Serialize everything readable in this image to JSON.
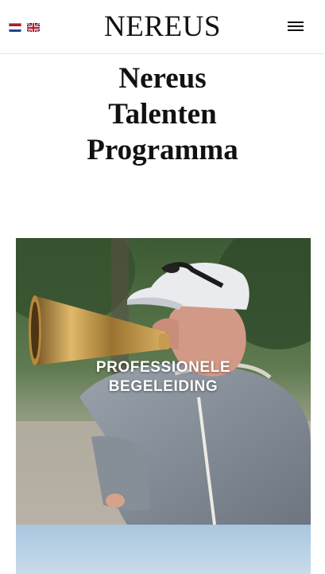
{
  "header": {
    "logo": "NEREUS",
    "languages": [
      {
        "code": "nl",
        "icon": "flag-nl-icon"
      },
      {
        "code": "en",
        "icon": "flag-uk-icon"
      }
    ],
    "menu_icon": "hamburger-menu-icon"
  },
  "page": {
    "title_lines": [
      "Nereus",
      "Talenten",
      "Programma"
    ]
  },
  "cards": [
    {
      "label_lines": [
        "PROFESSIONELE",
        "BEGELEIDING"
      ],
      "image": "coach-with-megaphone-photo"
    }
  ],
  "colors": {
    "text": "#111111",
    "card_label": "#ffffff",
    "border": "#e6e6e6"
  }
}
